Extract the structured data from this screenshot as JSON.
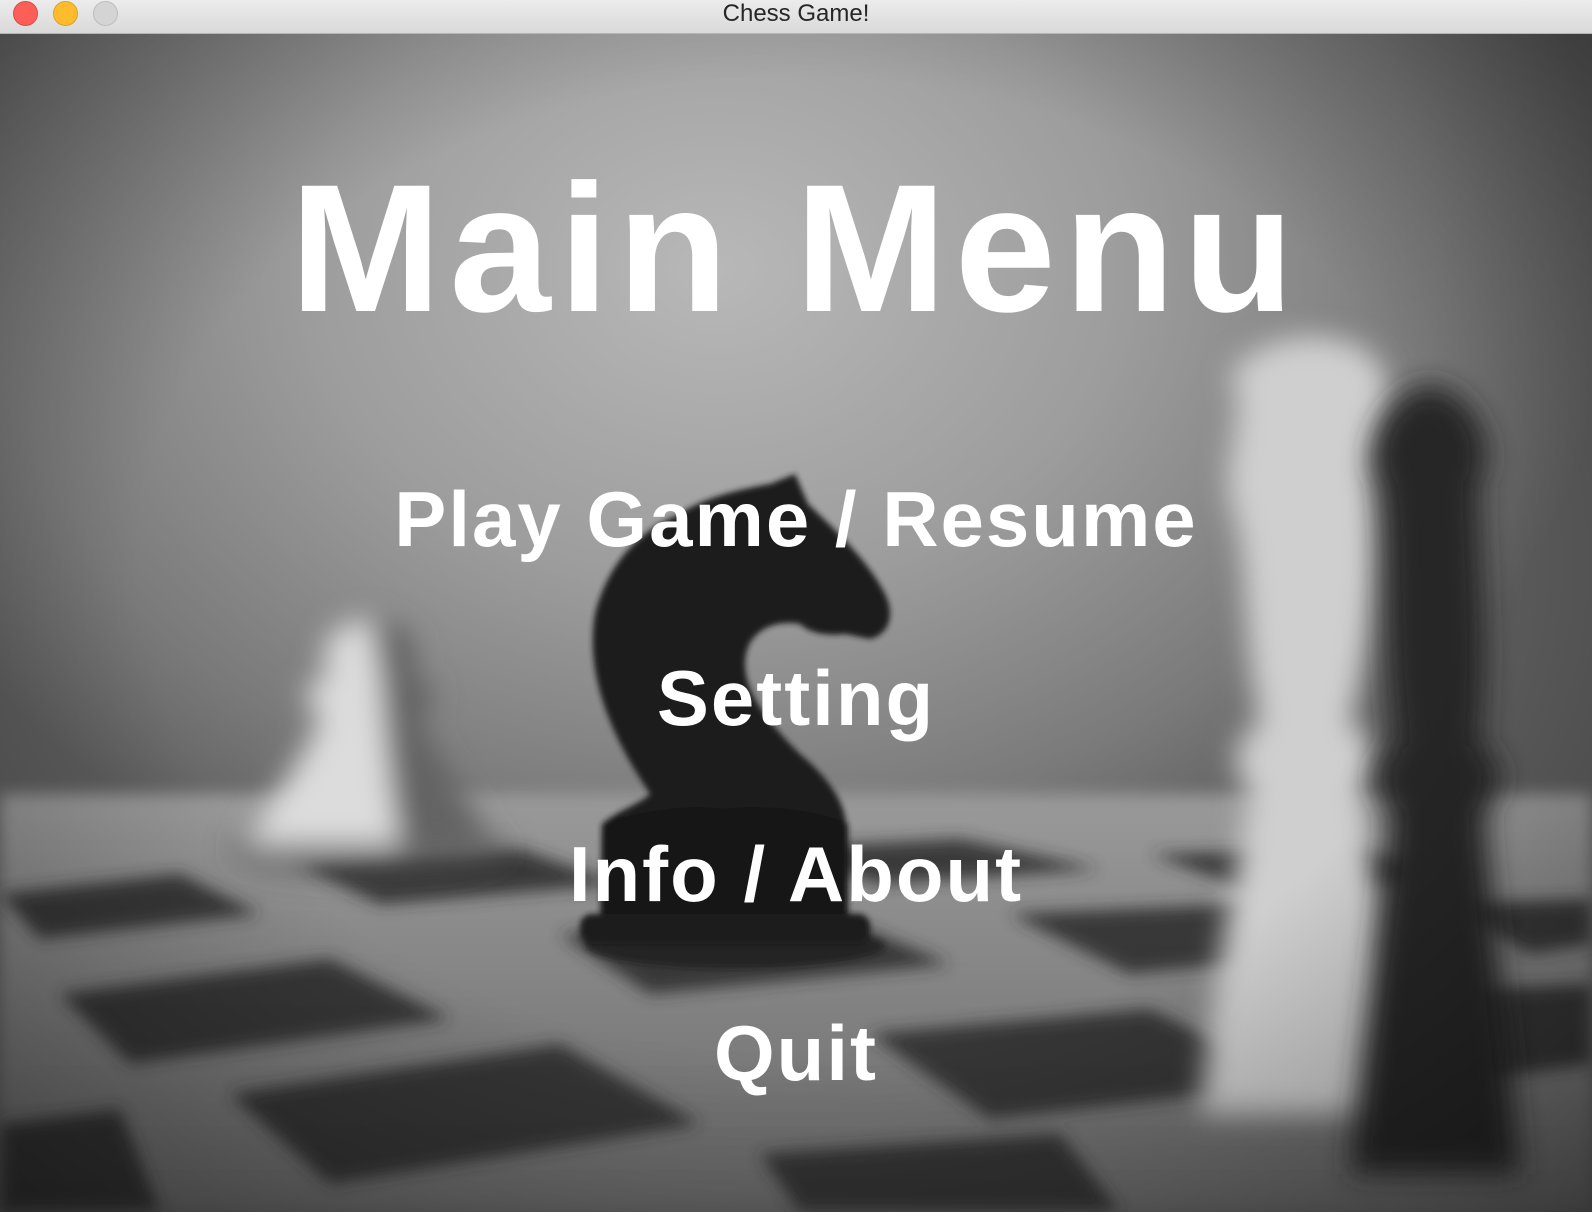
{
  "window": {
    "title": "Chess Game!"
  },
  "menu": {
    "title": "Main Menu",
    "items": [
      {
        "label": "Play Game / Resume"
      },
      {
        "label": "Setting"
      },
      {
        "label": "Info / About"
      },
      {
        "label": "Quit"
      }
    ]
  },
  "colors": {
    "text": "#ffffff",
    "background": "grayscale chess photo"
  }
}
